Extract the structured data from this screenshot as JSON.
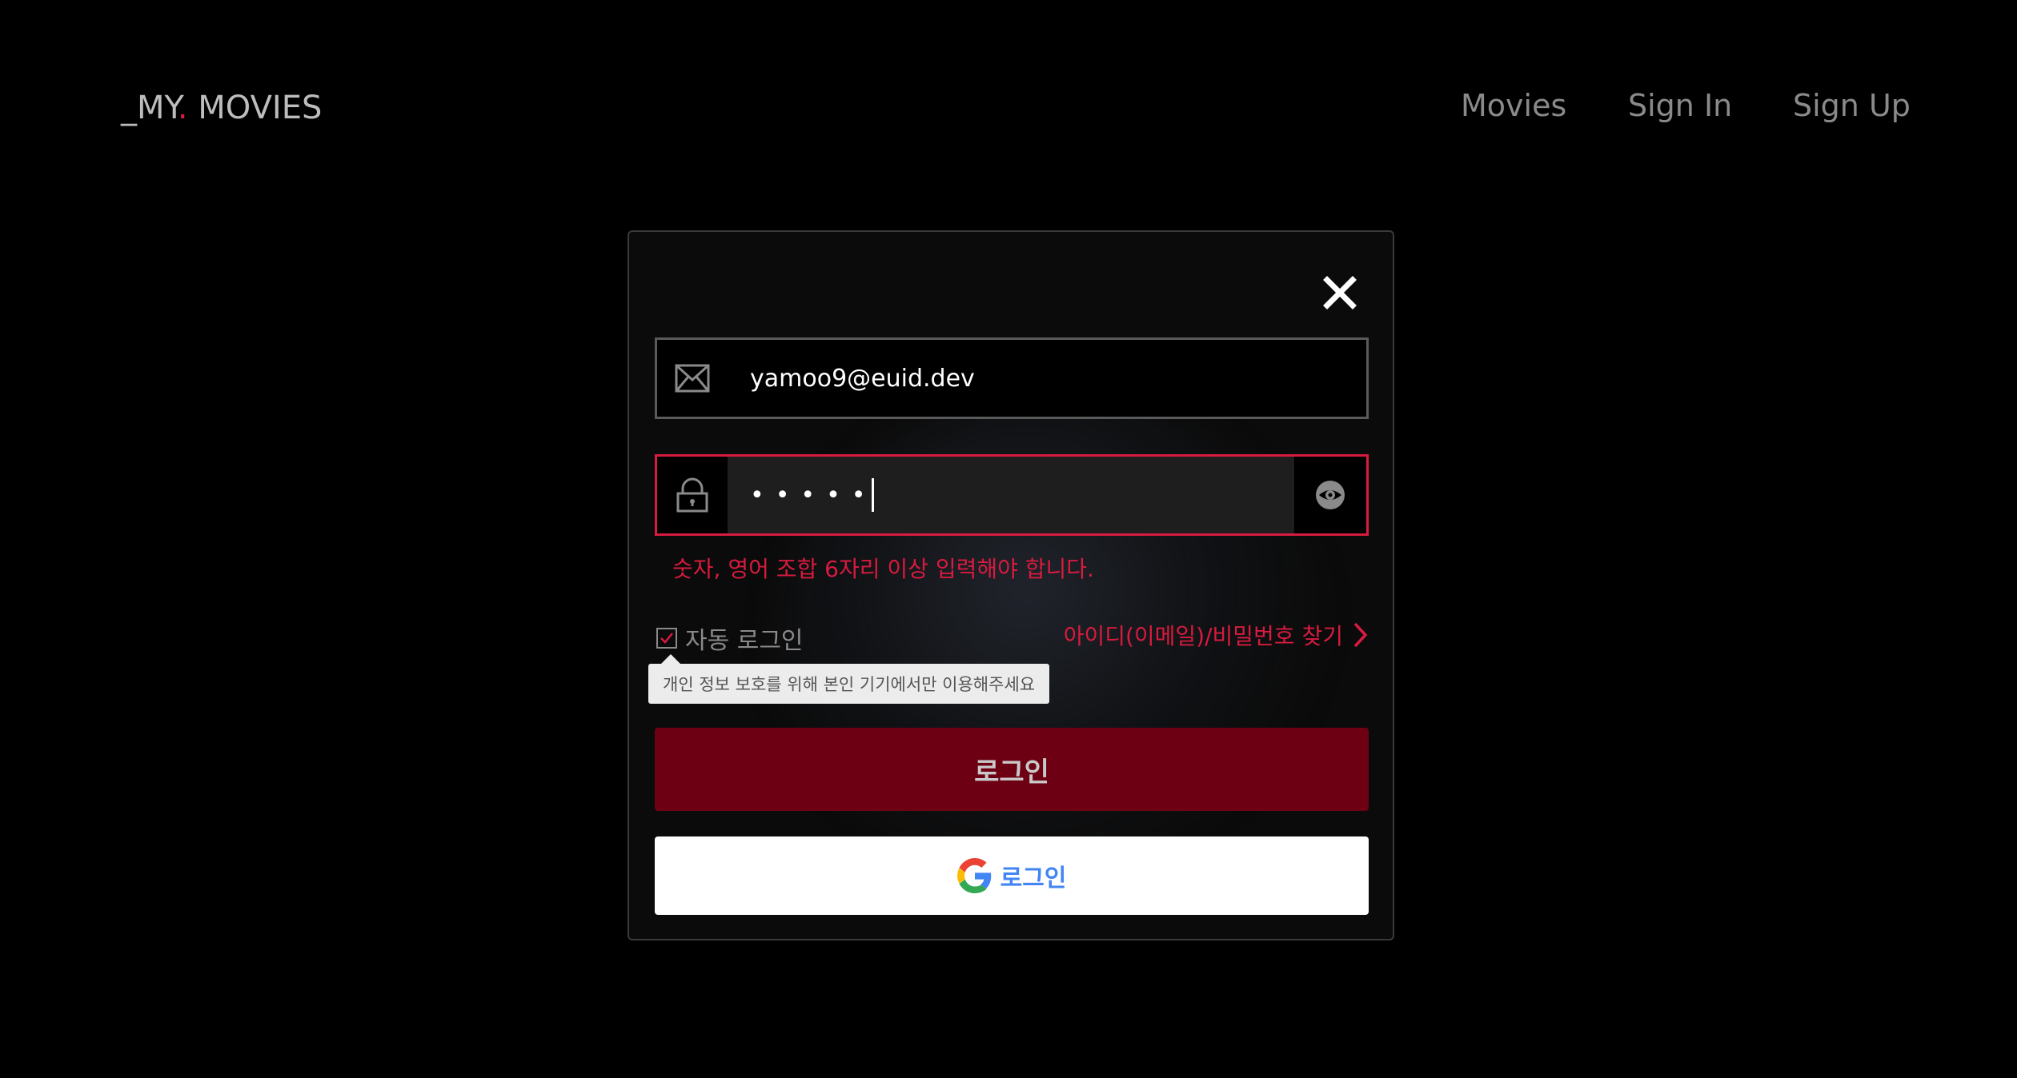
{
  "header": {
    "logo_prefix": "_MY",
    "logo_dot": ".",
    "logo_suffix": " MOVIES",
    "nav": [
      {
        "label": "Movies"
      },
      {
        "label": "Sign In"
      },
      {
        "label": "Sign Up"
      }
    ]
  },
  "login_modal": {
    "close_icon": "close-icon",
    "email": {
      "icon": "envelope-icon",
      "value": "yamoo9@euid.dev"
    },
    "password": {
      "icon": "lock-icon",
      "masked_value": "•••••",
      "toggle_icon": "eye-icon"
    },
    "error_message": "숫자, 영어 조합 6자리 이상 입력해야 합니다.",
    "remember": {
      "label": "자동 로그인",
      "checked": true
    },
    "find_link": "아이디(이메일)/비밀번호 찾기",
    "tooltip": "개인 정보 보호를 위해 본인 기기에서만 이용해주세요",
    "login_button": "로그인",
    "google_login_button": "로그인"
  },
  "colors": {
    "accent": "#d81b3f",
    "login_button_bg": "#6e0014",
    "google_text": "#4285f4",
    "background": "#000000"
  }
}
